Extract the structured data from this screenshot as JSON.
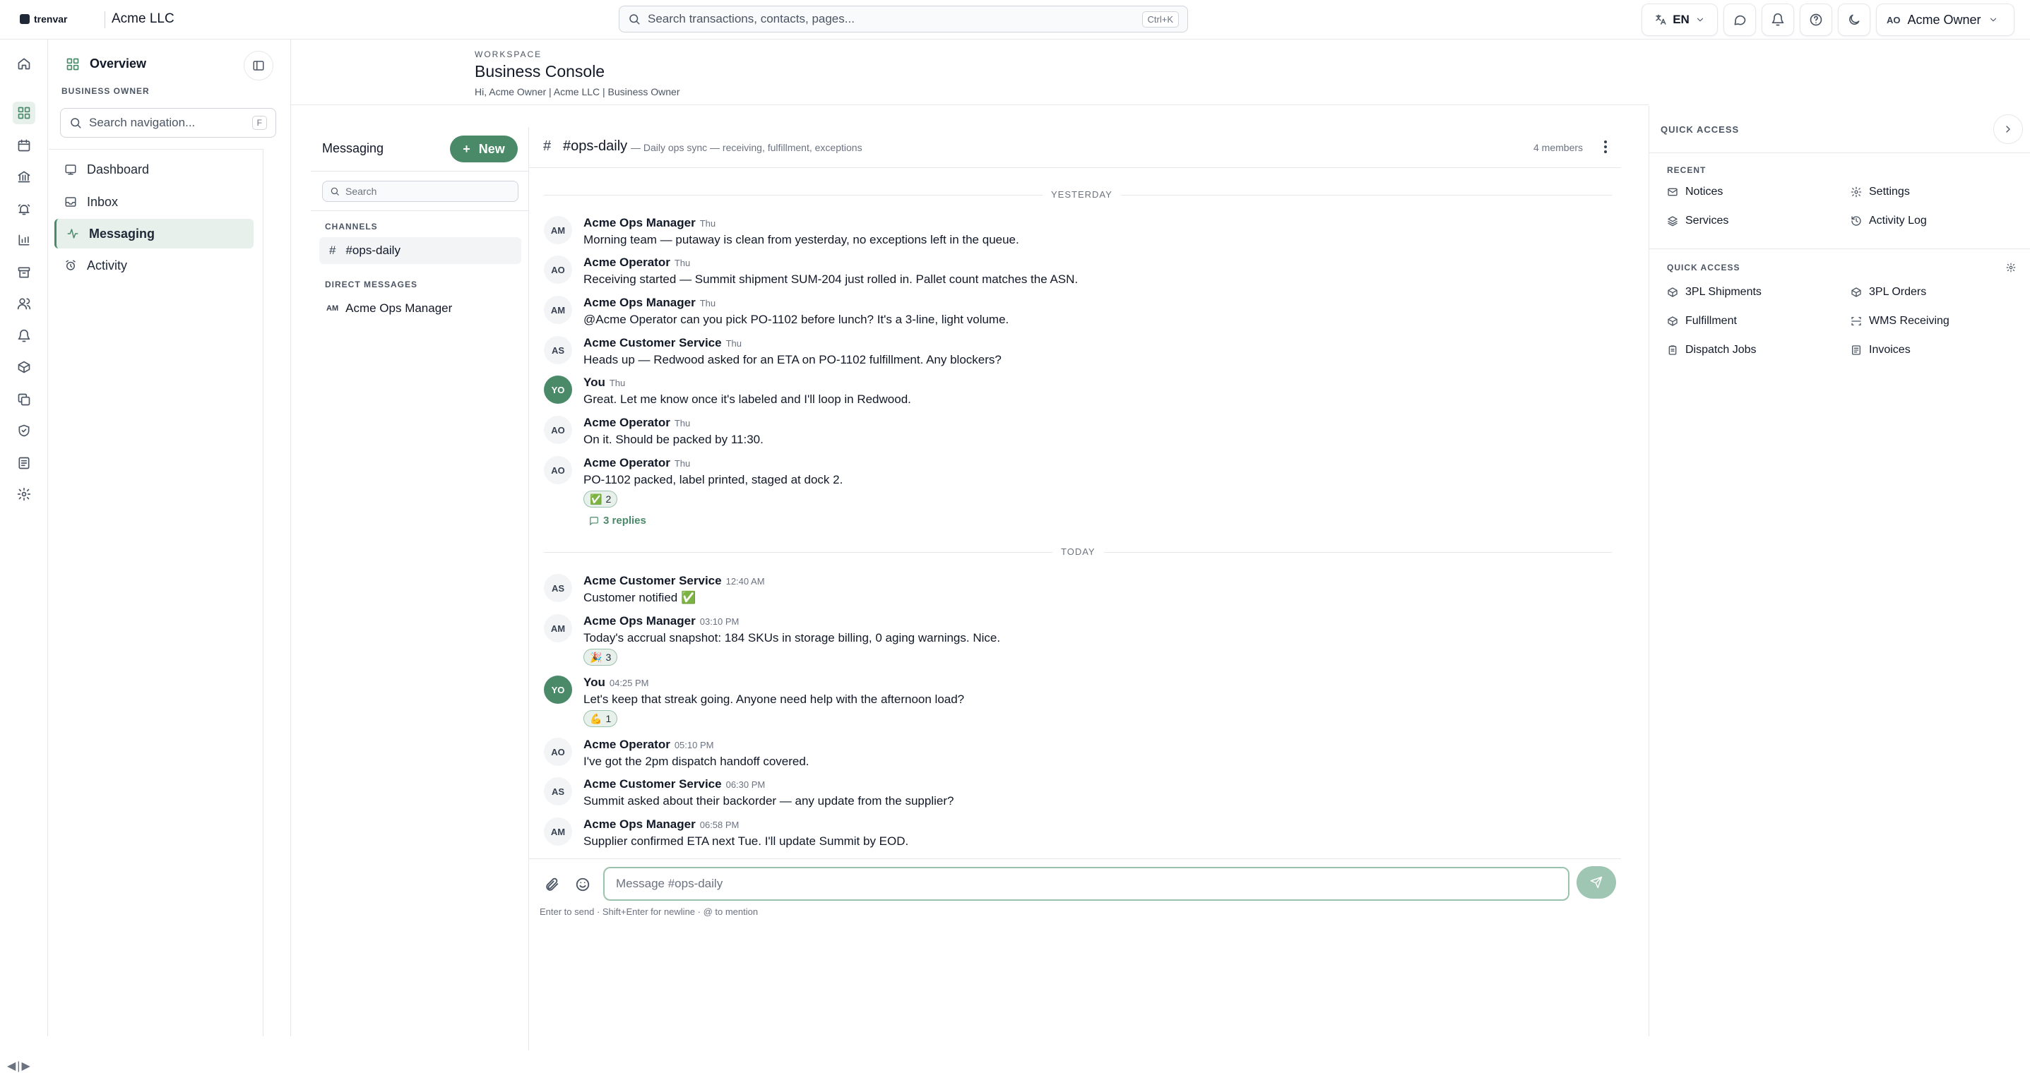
{
  "topbar": {
    "brand": "trenvar",
    "company": "Acme LLC",
    "search_placeholder": "Search transactions, contacts, pages...",
    "search_shortcut": "Ctrl+K",
    "language": "EN",
    "user_initials": "AO",
    "user_name": "Acme Owner"
  },
  "nav": {
    "section_title": "Overview",
    "role": "BUSINESS OWNER",
    "search_placeholder": "Search navigation...",
    "search_shortcut": "F",
    "items": [
      {
        "label": "Dashboard",
        "icon": "dashboard-icon"
      },
      {
        "label": "Inbox",
        "icon": "inbox-icon"
      },
      {
        "label": "Messaging",
        "icon": "activity-icon",
        "active": true
      },
      {
        "label": "Activity",
        "icon": "alarm-clock-icon"
      }
    ]
  },
  "workspace": {
    "eyebrow": "WORKSPACE",
    "title": "Business Console",
    "subtitle": "Hi, Acme Owner | Acme LLC | Business Owner"
  },
  "messaging": {
    "title": "Messaging",
    "new_label": "New",
    "search_placeholder": "Search",
    "channels_heading": "CHANNELS",
    "channel": "#ops-daily",
    "dm_heading": "DIRECT MESSAGES",
    "dm_initials": "AM",
    "dm_name": "Acme Ops Manager"
  },
  "chat": {
    "channel_hash": "#",
    "channel_name": "#ops-daily",
    "channel_desc": "— Daily ops sync — receiving, fulfillment, exceptions",
    "members": "4 members",
    "day_yesterday": "YESTERDAY",
    "day_today": "TODAY",
    "messages": [
      {
        "initials": "AM",
        "name": "Acme Ops Manager",
        "time": "Thu",
        "text": "Morning team — putaway is clean from yesterday, no exceptions left in the queue."
      },
      {
        "initials": "AO",
        "name": "Acme Operator",
        "time": "Thu",
        "text": "Receiving started — Summit shipment SUM-204 just rolled in. Pallet count matches the ASN."
      },
      {
        "initials": "AM",
        "name": "Acme Ops Manager",
        "time": "Thu",
        "text": "@Acme Operator can you pick PO-1102 before lunch? It's a 3-line, light volume."
      },
      {
        "initials": "AS",
        "name": "Acme Customer Service",
        "time": "Thu",
        "text": "Heads up — Redwood asked for an ETA on PO-1102 fulfillment. Any blockers?"
      },
      {
        "initials": "YO",
        "name": "You",
        "time": "Thu",
        "text": "Great. Let me know once it's labeled and I'll loop in Redwood."
      },
      {
        "initials": "AO",
        "name": "Acme Operator",
        "time": "Thu",
        "text": "On it. Should be packed by 11:30."
      },
      {
        "initials": "AO",
        "name": "Acme Operator",
        "time": "Thu",
        "text": "PO-1102 packed, label printed, staged at dock 2.",
        "reaction": "✅",
        "reaction_count": "2",
        "replies": "3 replies"
      },
      {
        "initials": "AS",
        "name": "Acme Customer Service",
        "time": "12:40 AM",
        "text": "Customer notified ✅"
      },
      {
        "initials": "AM",
        "name": "Acme Ops Manager",
        "time": "03:10 PM",
        "text": "Today's accrual snapshot: 184 SKUs in storage billing, 0 aging warnings. Nice.",
        "reaction": "🎉",
        "reaction_count": "3"
      },
      {
        "initials": "YO",
        "name": "You",
        "time": "04:25 PM",
        "text": "Let's keep that streak going. Anyone need help with the afternoon load?",
        "reaction": "💪",
        "reaction_count": "1"
      },
      {
        "initials": "AO",
        "name": "Acme Operator",
        "time": "05:10 PM",
        "text": "I've got the 2pm dispatch handoff covered."
      },
      {
        "initials": "AS",
        "name": "Acme Customer Service",
        "time": "06:30 PM",
        "text": "Summit asked about their backorder — any update from the supplier?"
      },
      {
        "initials": "AM",
        "name": "Acme Ops Manager",
        "time": "06:58 PM",
        "text": "Supplier confirmed ETA next Tue. I'll update Summit by EOD."
      }
    ],
    "composer_placeholder": "Message #ops-daily",
    "hint": "Enter to send · Shift+Enter for newline · @ to mention"
  },
  "quick_panel": {
    "title": "QUICK ACCESS",
    "recent_heading": "RECENT",
    "recent": [
      {
        "label": "Notices",
        "icon": "mail-icon"
      },
      {
        "label": "Settings",
        "icon": "gear-icon"
      },
      {
        "label": "Services",
        "icon": "layers-icon"
      },
      {
        "label": "Activity Log",
        "icon": "history-icon"
      }
    ],
    "quick_heading": "QUICK ACCESS",
    "quick": [
      {
        "label": "3PL Shipments",
        "icon": "package-icon"
      },
      {
        "label": "3PL Orders",
        "icon": "package-icon"
      },
      {
        "label": "Fulfillment",
        "icon": "package-icon"
      },
      {
        "label": "WMS Receiving",
        "icon": "scan-icon"
      },
      {
        "label": "Dispatch Jobs",
        "icon": "clipboard-icon"
      },
      {
        "label": "Invoices",
        "icon": "receipt-icon"
      }
    ]
  },
  "colors": {
    "accent": "#4a8a69",
    "accent_light": "#e8f0ec",
    "border": "#e5e7eb"
  }
}
